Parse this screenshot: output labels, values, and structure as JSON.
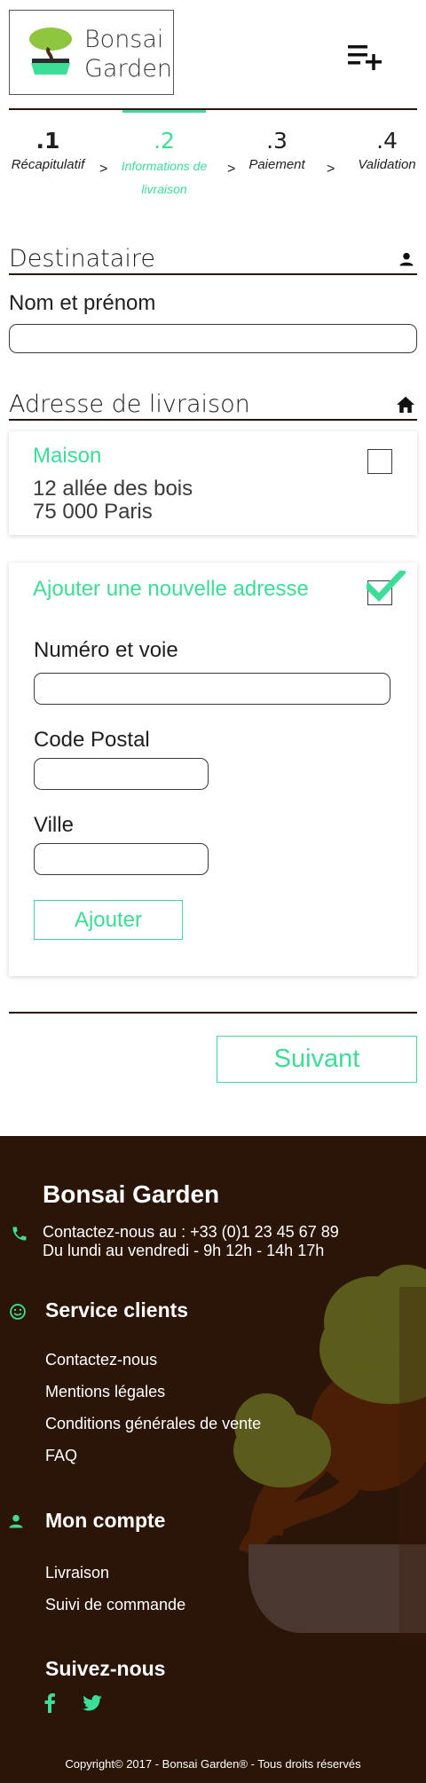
{
  "header": {
    "logo_line1": "Bonsai",
    "logo_line2": "Garden",
    "menu_icon": "playlist-add-icon"
  },
  "stepper": {
    "active_index": 1,
    "steps": [
      {
        "number": ".1",
        "label": "Récapitulatif"
      },
      {
        "number": ".2",
        "label_line1": "Informations de",
        "label_line2": "livraison"
      },
      {
        "number": ".3",
        "label": "Paiement"
      },
      {
        "number": ".4",
        "label": "Validation"
      }
    ],
    "separator": ">"
  },
  "recipient": {
    "title": "Destinataire",
    "icon": "person-icon",
    "name_label": "Nom et prénom",
    "name_value": ""
  },
  "delivery": {
    "title": "Adresse de livraison",
    "icon": "home-icon",
    "saved_address": {
      "name": "Maison",
      "line1": "12 allée des bois",
      "line2": "75  000 Paris",
      "checked": false
    },
    "new_address": {
      "title": "Ajouter une nouvelle adresse",
      "checked": true,
      "street_label": "Numéro et voie",
      "postal_label": "Code Postal",
      "city_label": "Ville",
      "add_button": "Ajouter"
    }
  },
  "next_button": "Suivant",
  "footer": {
    "brand": "Bonsai Garden",
    "contact_line1": "Contactez-nous au : +33 (0)1 23 45 67 89",
    "contact_line2": "Du lundi au vendredi - 9h 12h - 14h 17h",
    "service_title": "Service clients",
    "service_links": [
      "Contactez-nous",
      "Mentions légales",
      "Conditions générales de vente",
      "FAQ"
    ],
    "account_title": "Mon compte",
    "account_links": [
      "Livraison",
      "Suivi de commande"
    ],
    "follow_title": "Suivez-nous",
    "social_icons": [
      "facebook-icon",
      "twitter-icon"
    ],
    "copyright": "Copyright© 2017 - Bonsai Garden® - Tous droits réservés"
  },
  "colors": {
    "accent": "#3ddc97",
    "dark_brown": "#2a1508",
    "text": "#1f1f1f"
  }
}
